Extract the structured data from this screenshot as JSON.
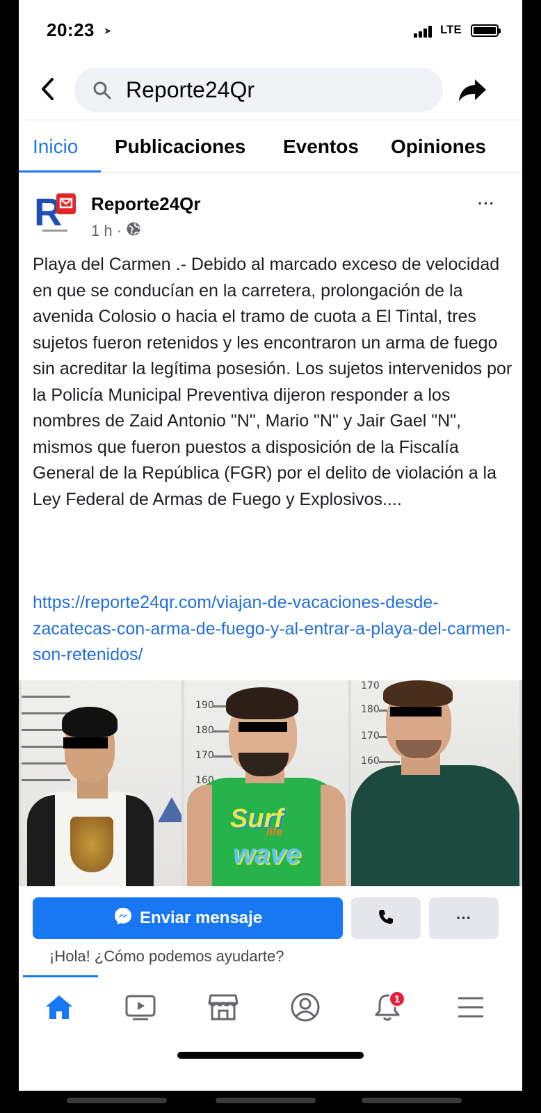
{
  "status_bar": {
    "time": "20:23",
    "network": "LTE"
  },
  "search": {
    "query": "Reporte24Qr"
  },
  "tabs": [
    {
      "label": "Inicio",
      "active": true
    },
    {
      "label": "Publicaciones",
      "active": false
    },
    {
      "label": "Eventos",
      "active": false
    },
    {
      "label": "Opiniones",
      "active": false
    }
  ],
  "post": {
    "author": "Reporte24Qr",
    "time": "1 h ·",
    "more": "···",
    "text": "Playa del Carmen .- Debido al marcado exceso de velocidad en que se conducían en la carretera, prolongación de la avenida Colosio o hacia el tramo de cuota a El Tintal, tres sujetos fueron retenidos y les encontraron un arma de fuego sin acreditar la legítima posesión. Los sujetos intervenidos por la Policía Municipal Preventiva dijeron responder a los nombres de Zaid Antonio \"N\", Mario \"N\" y Jair Gael \"N\", mismos que fueron puestos a disposición de la Fiscalía General de la República (FGR) por el delito de violación a la Ley Federal de Armas de Fuego y Explosivos....",
    "link": "https://reporte24qr.com/viajan-de-vacaciones-desde-zacatecas-con-arma-de-fuego-y-al-entrar-a-playa-del-carmen-son-retenidos/",
    "photo_scale_labels": {
      "middle": [
        "190",
        "180",
        "170",
        "160"
      ],
      "right": [
        "170",
        "180",
        "170",
        "160"
      ]
    },
    "shirt_print": [
      "Surf",
      "life",
      "wave"
    ]
  },
  "actions": {
    "message_label": "Enviar mensaje",
    "more": "···",
    "greeting": "¡Hola! ¿Cómo podemos ayudarte?"
  },
  "nav": {
    "notifications_count": "1"
  },
  "colors": {
    "facebook_blue": "#1877f2",
    "link": "#216fdb",
    "badge_red": "#e41e3f"
  }
}
